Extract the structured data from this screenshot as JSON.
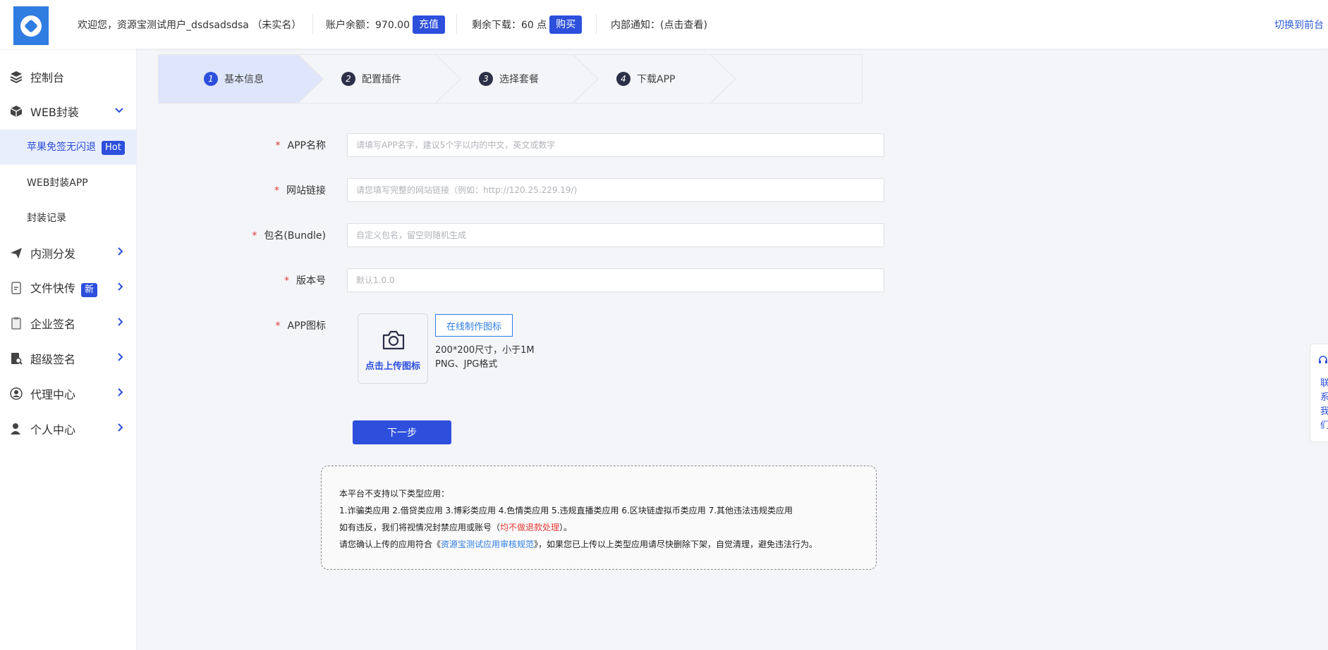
{
  "header": {
    "welcome": "欢迎您，资源宝测试用户_dsdsadsdsa （未实名）",
    "balance_label": "账户余额：970.00",
    "recharge_btn": "充值",
    "downloads_label": "剩余下载：60 点",
    "buy_btn": "购买",
    "notice_label": "内部通知：(点击查看)",
    "switch_front": "切换到前台"
  },
  "sidebar": {
    "items": [
      {
        "label": "控制台",
        "icon": "layers-icon"
      },
      {
        "label": "WEB封装",
        "icon": "box-icon"
      },
      {
        "label": "苹果免签无闪退",
        "badge": "Hot"
      },
      {
        "label": "WEB封装APP"
      },
      {
        "label": "封装记录"
      },
      {
        "label": "内测分发",
        "icon": "paper-plane-icon"
      },
      {
        "label": "文件快传",
        "icon": "file-transfer-icon",
        "badge": "新"
      },
      {
        "label": "企业签名",
        "icon": "clipboard-icon"
      },
      {
        "label": "超级签名",
        "icon": "document-search-icon"
      },
      {
        "label": "代理中心",
        "icon": "agent-icon"
      },
      {
        "label": "个人中心",
        "icon": "user-icon"
      }
    ]
  },
  "steps": [
    {
      "num": "1",
      "label": "基本信息"
    },
    {
      "num": "2",
      "label": "配置插件"
    },
    {
      "num": "3",
      "label": "选择套餐"
    },
    {
      "num": "4",
      "label": "下载APP"
    }
  ],
  "form": {
    "app_name": {
      "label": "APP名称",
      "placeholder": "请填写APP名字，建议5个字以内的中文，英文或数字"
    },
    "site_url": {
      "label": "网站链接",
      "placeholder": "请您填写完整的网站链接（例如：http://120.25.229.19/)"
    },
    "bundle": {
      "label": "包名(Bundle)",
      "placeholder": "自定义包名，留空则随机生成"
    },
    "version": {
      "label": "版本号",
      "placeholder": "默认1.0.0"
    },
    "icon": {
      "label": "APP图标",
      "upload_text": "点击上传图标",
      "online_btn": "在线制作图标",
      "size_tip": "200*200尺寸，小于1M",
      "format_tip": "PNG、JPG格式"
    },
    "required_mark": "*",
    "next_btn": "下一步"
  },
  "notice": {
    "line1": "本平台不支持以下类型应用：",
    "line2": "1.诈骗类应用 2.借贷类应用 3.博彩类应用 4.色情类应用 5.违规直播类应用 6.区块链虚拟币类应用 7.其他违法违规类应用",
    "line3_a": "如有违反，我们将视情况封禁应用或账号（",
    "line3_red": "均不做退款处理",
    "line3_b": "）。",
    "line4_a": "请您确认上传的应用符合《",
    "line4_link": "资源宝测试应用审核规范",
    "line4_b": "》，如果您已上传以上类型应用请尽快删除下架，自觉清理，避免违法行为。"
  },
  "float_contact": {
    "chars": [
      "联",
      "系",
      "我",
      "们"
    ]
  },
  "colors": {
    "primary": "#2d4fdc",
    "link": "#2d7de0",
    "danger": "#e53935"
  }
}
